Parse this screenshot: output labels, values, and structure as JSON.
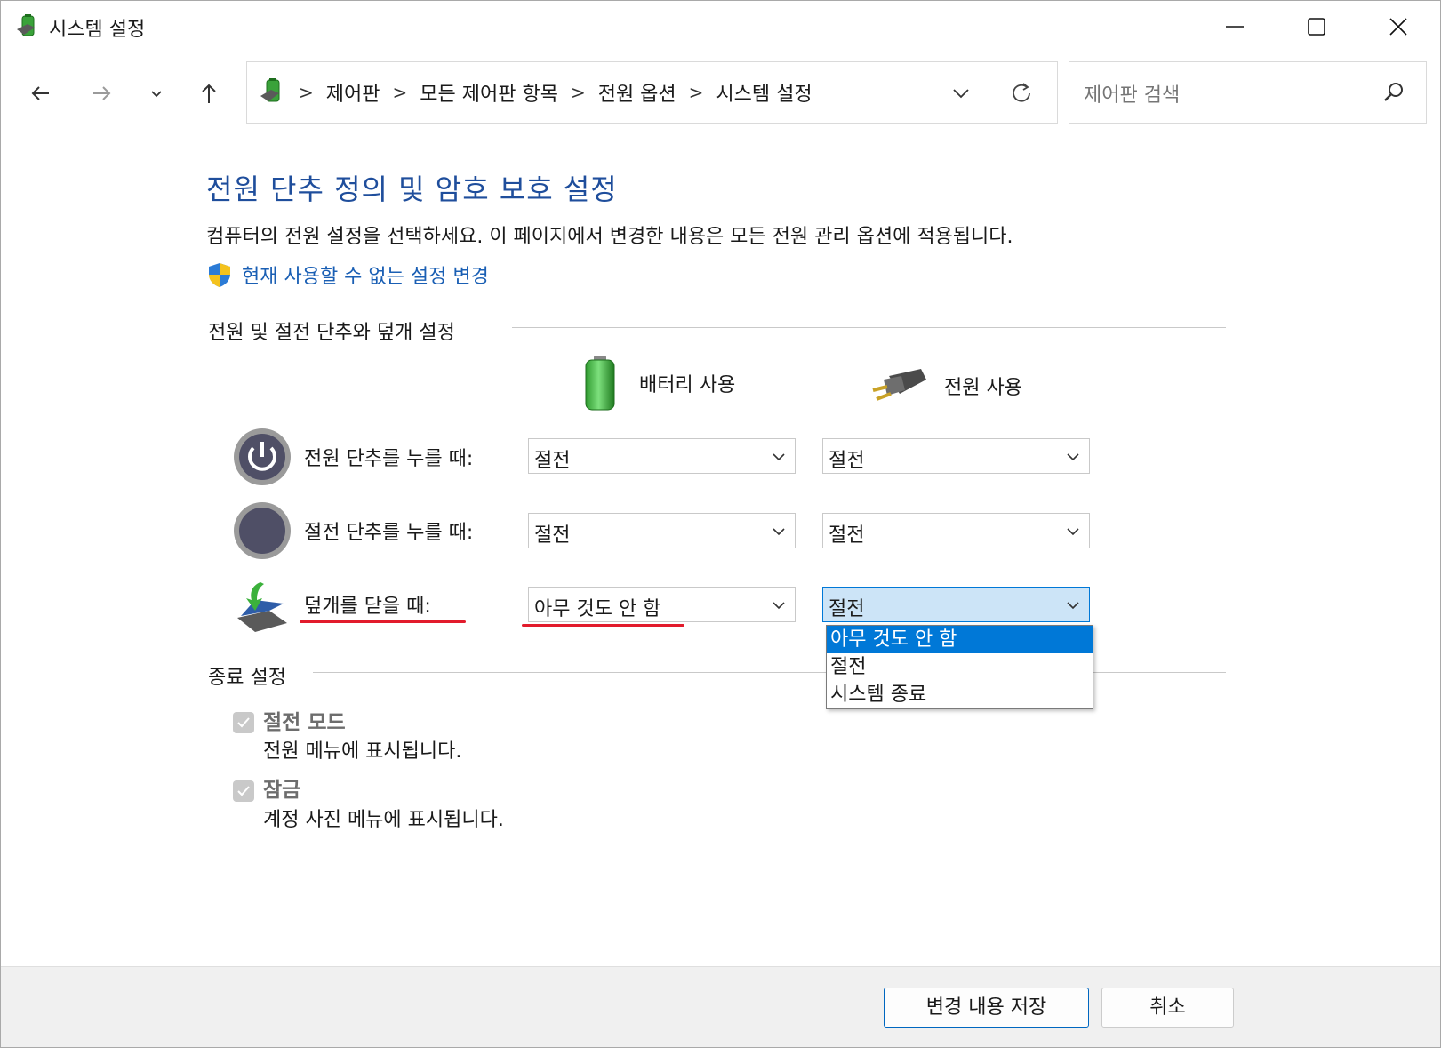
{
  "window": {
    "title": "시스템 설정",
    "controls": [
      "minimize",
      "maximize",
      "close"
    ]
  },
  "nav": {
    "icons": [
      "back-arrow-icon",
      "forward-arrow-icon",
      "recent-locations-chevron-icon",
      "up-arrow-icon"
    ]
  },
  "address": {
    "crumbs": [
      "제어판",
      "모든 제어판 항목",
      "전원 옵션",
      "시스템 설정"
    ],
    "separator": ">"
  },
  "search": {
    "placeholder": "제어판 검색"
  },
  "page": {
    "title": "전원 단추 정의 및 암호 보호 설정",
    "description": "컴퓨터의 전원 설정을 선택하세요. 이 페이지에서 변경한 내용은 모든 전원 관리 옵션에 적용됩니다.",
    "admin_link": "현재 사용할 수 없는 설정 변경"
  },
  "power_section": {
    "heading": "전원 및 절전 단추와 덮개 설정",
    "col_battery": "배터리 사용",
    "col_plugged": "전원 사용",
    "rows": [
      {
        "label": "전원 단추를 누를 때:",
        "battery": "절전",
        "plugged": "절전"
      },
      {
        "label": "절전 단추를 누를 때:",
        "battery": "절전",
        "plugged": "절전"
      },
      {
        "label": "덮개를 닫을 때:",
        "battery": "아무 것도 안 함",
        "plugged": "절전"
      }
    ],
    "open_dropdown": {
      "options": [
        "아무 것도 안 함",
        "절전",
        "시스템 종료"
      ],
      "highlighted": "아무 것도 안 함"
    }
  },
  "shutdown_section": {
    "heading": "종료 설정",
    "items": [
      {
        "title": "절전 모드",
        "desc": "전원 메뉴에 표시됩니다.",
        "checked": true,
        "enabled": false
      },
      {
        "title": "잠금",
        "desc": "계정 사진 메뉴에 표시됩니다.",
        "checked": true,
        "enabled": false
      }
    ]
  },
  "footer": {
    "save": "변경 내용 저장",
    "cancel": "취소"
  },
  "colors": {
    "title_blue": "#1f4e9c",
    "link_blue": "#1a5fb4",
    "accent": "#0078d7",
    "annotation_red": "#e21b2c"
  }
}
